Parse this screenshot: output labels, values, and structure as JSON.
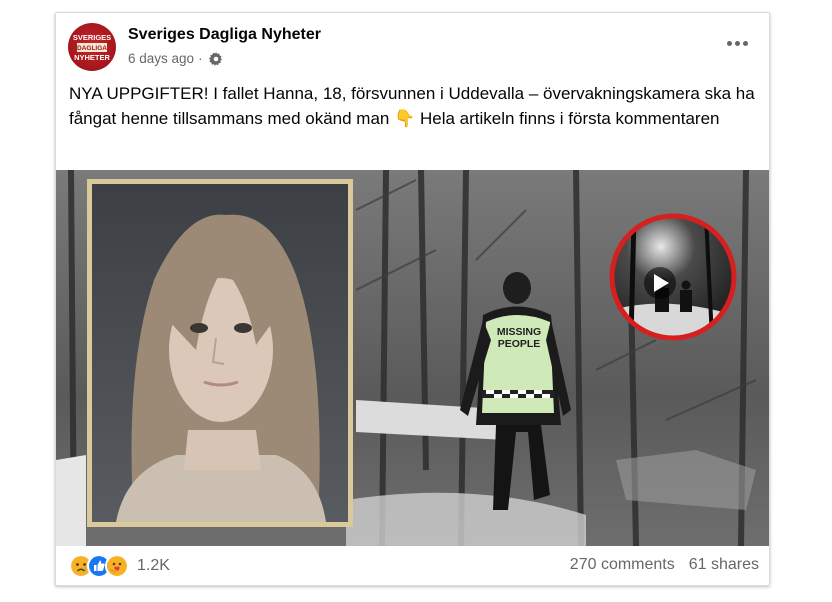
{
  "post": {
    "page_name": "Sveriges Dagliga Nyheter",
    "timestamp": "6 days ago",
    "separator": "·",
    "privacy_icon": "gear-icon",
    "caption": "NYA UPPGIFTER! I fallet Hanna, 18, försvunnen i Uddevalla – övervakningskamera ska ha fångat henne tillsammans med okänd man 👇 Hela artikeln finns i första kommentaren"
  },
  "avatar_logo": {
    "line1": "SVERIGES",
    "line2": "DAGLIGA",
    "line3": "NYHETER",
    "color": "#b5191f"
  },
  "image": {
    "vest_line1": "MISSING",
    "vest_line2": "PEOPLE",
    "inset_icon": "play-icon",
    "inset_ring_color": "#d61f1f"
  },
  "footer": {
    "reaction_icons": [
      "sad-icon",
      "like-icon",
      "care-icon"
    ],
    "reaction_count": "1.2K",
    "comments": "270 comments",
    "shares": "61 shares"
  }
}
